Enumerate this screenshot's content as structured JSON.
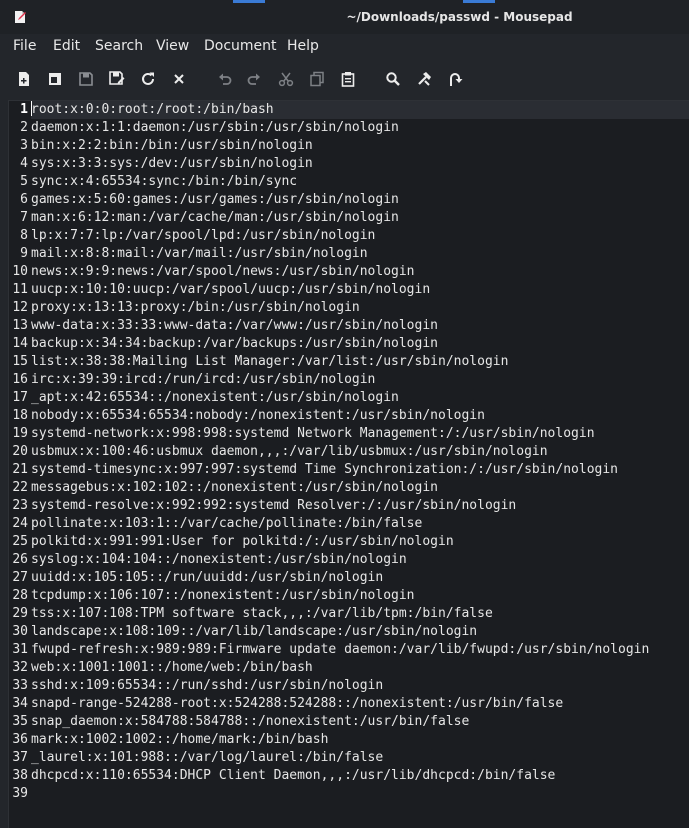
{
  "window": {
    "title": "~/Downloads/passwd - Mousepad"
  },
  "menu": [
    {
      "label": "File"
    },
    {
      "label": "Edit"
    },
    {
      "label": "Search"
    },
    {
      "label": "View"
    },
    {
      "label": "Document"
    },
    {
      "label": "Help"
    }
  ],
  "toolbar": [
    {
      "icon": "new-document-icon"
    },
    {
      "icon": "new-window-icon"
    },
    {
      "icon": "save-icon"
    },
    {
      "icon": "save-as-icon"
    },
    {
      "icon": "reload-icon"
    },
    {
      "icon": "close-icon"
    },
    {
      "icon": "undo-icon"
    },
    {
      "icon": "redo-icon"
    },
    {
      "icon": "cut-icon"
    },
    {
      "icon": "copy-icon"
    },
    {
      "icon": "paste-icon"
    },
    {
      "icon": "find-icon"
    },
    {
      "icon": "find-replace-icon"
    },
    {
      "icon": "go-to-line-icon"
    }
  ],
  "editor": {
    "current_line": 1,
    "lines": [
      "root:x:0:0:root:/root:/bin/bash",
      "daemon:x:1:1:daemon:/usr/sbin:/usr/sbin/nologin",
      "bin:x:2:2:bin:/bin:/usr/sbin/nologin",
      "sys:x:3:3:sys:/dev:/usr/sbin/nologin",
      "sync:x:4:65534:sync:/bin:/bin/sync",
      "games:x:5:60:games:/usr/games:/usr/sbin/nologin",
      "man:x:6:12:man:/var/cache/man:/usr/sbin/nologin",
      "lp:x:7:7:lp:/var/spool/lpd:/usr/sbin/nologin",
      "mail:x:8:8:mail:/var/mail:/usr/sbin/nologin",
      "news:x:9:9:news:/var/spool/news:/usr/sbin/nologin",
      "uucp:x:10:10:uucp:/var/spool/uucp:/usr/sbin/nologin",
      "proxy:x:13:13:proxy:/bin:/usr/sbin/nologin",
      "www-data:x:33:33:www-data:/var/www:/usr/sbin/nologin",
      "backup:x:34:34:backup:/var/backups:/usr/sbin/nologin",
      "list:x:38:38:Mailing List Manager:/var/list:/usr/sbin/nologin",
      "irc:x:39:39:ircd:/run/ircd:/usr/sbin/nologin",
      "_apt:x:42:65534::/nonexistent:/usr/sbin/nologin",
      "nobody:x:65534:65534:nobody:/nonexistent:/usr/sbin/nologin",
      "systemd-network:x:998:998:systemd Network Management:/:/usr/sbin/nologin",
      "usbmux:x:100:46:usbmux daemon,,,:/var/lib/usbmux:/usr/sbin/nologin",
      "systemd-timesync:x:997:997:systemd Time Synchronization:/:/usr/sbin/nologin",
      "messagebus:x:102:102::/nonexistent:/usr/sbin/nologin",
      "systemd-resolve:x:992:992:systemd Resolver:/:/usr/sbin/nologin",
      "pollinate:x:103:1::/var/cache/pollinate:/bin/false",
      "polkitd:x:991:991:User for polkitd:/:/usr/sbin/nologin",
      "syslog:x:104:104::/nonexistent:/usr/sbin/nologin",
      "uuidd:x:105:105::/run/uuidd:/usr/sbin/nologin",
      "tcpdump:x:106:107::/nonexistent:/usr/sbin/nologin",
      "tss:x:107:108:TPM software stack,,,:/var/lib/tpm:/bin/false",
      "landscape:x:108:109::/var/lib/landscape:/usr/sbin/nologin",
      "fwupd-refresh:x:989:989:Firmware update daemon:/var/lib/fwupd:/usr/sbin/nologin",
      "web:x:1001:1001::/home/web:/bin/bash",
      "sshd:x:109:65534::/run/sshd:/usr/sbin/nologin",
      "snapd-range-524288-root:x:524288:524288::/nonexistent:/usr/bin/false",
      "snap_daemon:x:584788:584788::/nonexistent:/usr/bin/false",
      "mark:x:1002:1002::/home/mark:/bin/bash",
      "_laurel:x:101:988::/var/log/laurel:/bin/false",
      "dhcpcd:x:110:65534:DHCP Client Daemon,,,:/usr/lib/dhcpcd:/bin/false",
      ""
    ]
  },
  "colors": {
    "background": "#23262b",
    "editor_background": "#1b1d21",
    "text": "#e6e6e6",
    "accent": "#3a7bd5"
  }
}
